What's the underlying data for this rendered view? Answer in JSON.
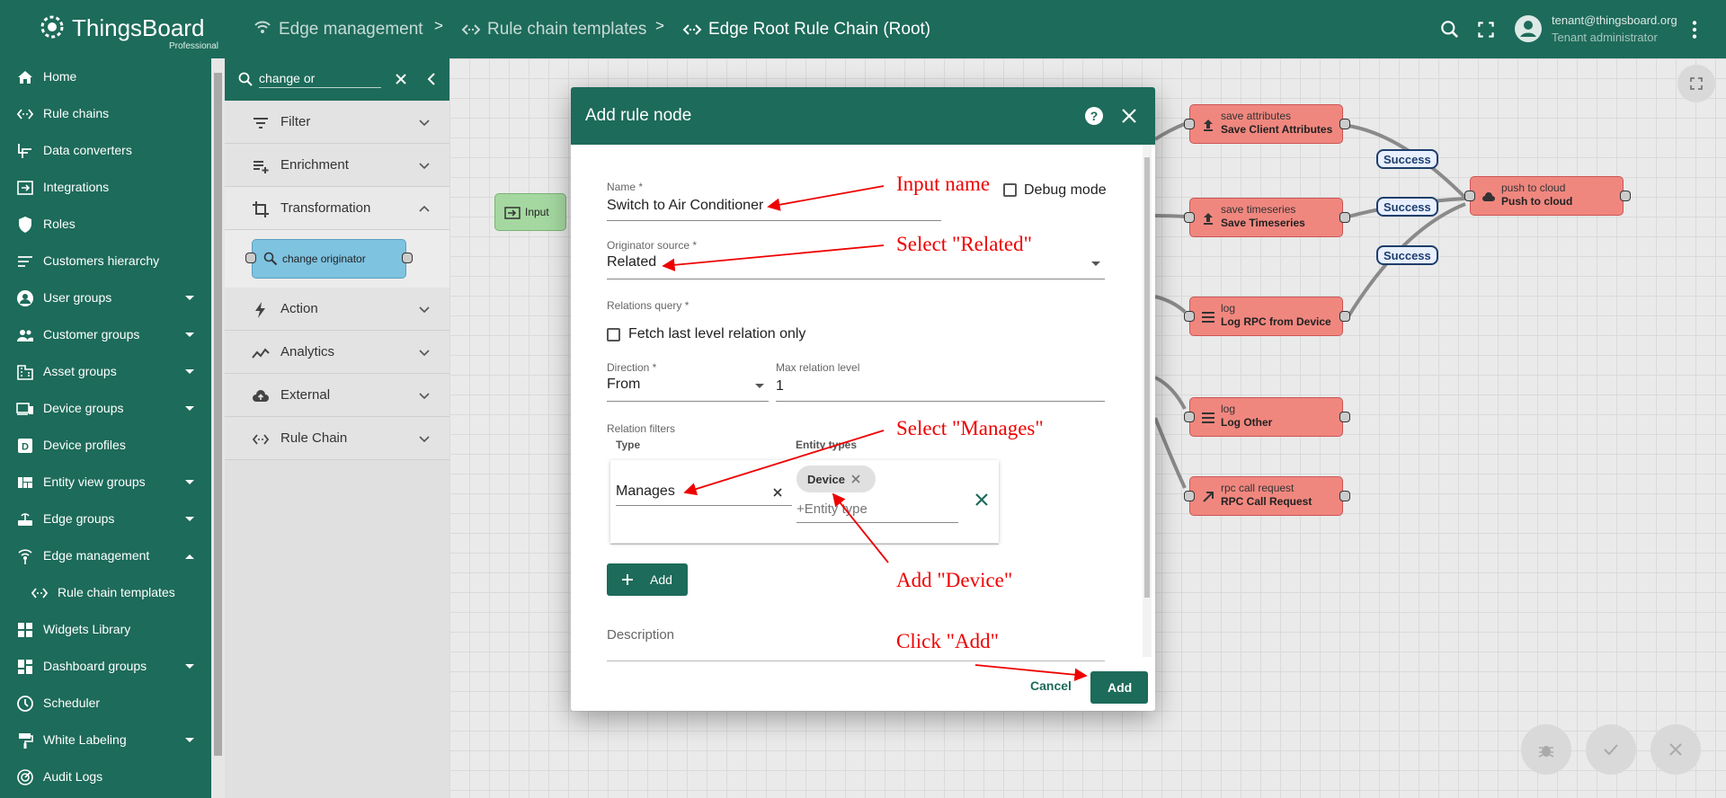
{
  "header": {
    "logo_name": "ThingsBoard",
    "logo_edition": "Professional",
    "breadcrumbs": [
      "Edge management",
      "Rule chain templates",
      "Edge Root Rule Chain (Root)"
    ],
    "separator": ">",
    "user_email": "tenant@thingsboard.org",
    "user_role": "Tenant administrator"
  },
  "sidebar": {
    "items": [
      {
        "label": "Home",
        "icon": "home-icon"
      },
      {
        "label": "Rule chains",
        "icon": "rule-chain-icon"
      },
      {
        "label": "Data converters",
        "icon": "converter-icon"
      },
      {
        "label": "Integrations",
        "icon": "integration-icon"
      },
      {
        "label": "Roles",
        "icon": "shield-icon"
      },
      {
        "label": "Customers hierarchy",
        "icon": "hierarchy-icon"
      },
      {
        "label": "User groups",
        "icon": "account-circle-icon"
      },
      {
        "label": "Customer groups",
        "icon": "people-icon"
      },
      {
        "label": "Asset groups",
        "icon": "domain-icon"
      },
      {
        "label": "Device groups",
        "icon": "devices-icon"
      },
      {
        "label": "Device profiles",
        "icon": "device-profile-icon"
      },
      {
        "label": "Entity view groups",
        "icon": "view-quilt-icon"
      },
      {
        "label": "Edge groups",
        "icon": "router-icon"
      },
      {
        "label": "Edge management",
        "icon": "edge-icon"
      },
      {
        "label": "Rule chain templates",
        "icon": "rule-chain-icon"
      },
      {
        "label": "Widgets Library",
        "icon": "widgets-icon"
      },
      {
        "label": "Dashboard groups",
        "icon": "dashboard-icon"
      },
      {
        "label": "Scheduler",
        "icon": "clock-icon"
      },
      {
        "label": "White Labeling",
        "icon": "format-paint-icon"
      },
      {
        "label": "Audit Logs",
        "icon": "track-changes-icon"
      }
    ]
  },
  "library": {
    "search_value": "change or",
    "categories": [
      "Filter",
      "Enrichment",
      "Transformation",
      "Action",
      "Analytics",
      "External",
      "Rule Chain"
    ],
    "node_label": "change originator"
  },
  "canvas": {
    "input_label": "Input",
    "nodes": [
      {
        "type": "save attributes",
        "name": "Save Client Attributes"
      },
      {
        "type": "save timeseries",
        "name": "Save Timeseries"
      },
      {
        "type": "log",
        "name": "Log RPC from Device"
      },
      {
        "type": "log",
        "name": "Log Other"
      },
      {
        "type": "rpc call request",
        "name": "RPC Call Request"
      },
      {
        "type": "push to cloud",
        "name": "Push to cloud"
      }
    ],
    "link_label": "Success"
  },
  "dialog": {
    "title": "Add rule node",
    "name_label": "Name *",
    "name_value": "Switch to Air Conditioner",
    "debug_label": "Debug mode",
    "originator_label": "Originator source *",
    "originator_value": "Related",
    "relations_query_label": "Relations query *",
    "fetch_last_label": "Fetch last level relation only",
    "direction_label": "Direction *",
    "direction_value": "From",
    "max_level_label": "Max relation level",
    "max_level_value": "1",
    "relation_filters_label": "Relation filters",
    "type_col": "Type",
    "entity_types_col": "Entity types",
    "type_value": "Manages",
    "chip_value": "Device",
    "entity_placeholder": "+Entity type",
    "add_filter_label": "Add",
    "description_label": "Description",
    "cancel_label": "Cancel",
    "add_label": "Add"
  },
  "annotations": {
    "input_name": "Input name",
    "select_related": "Select \"Related\"",
    "select_manages": "Select \"Manages\"",
    "add_device": "Add \"Device\"",
    "click_add": "Click \"Add\""
  },
  "colors": {
    "primary": "#1d6b5a",
    "node": "#f0877f",
    "annotation": "#e00000"
  }
}
